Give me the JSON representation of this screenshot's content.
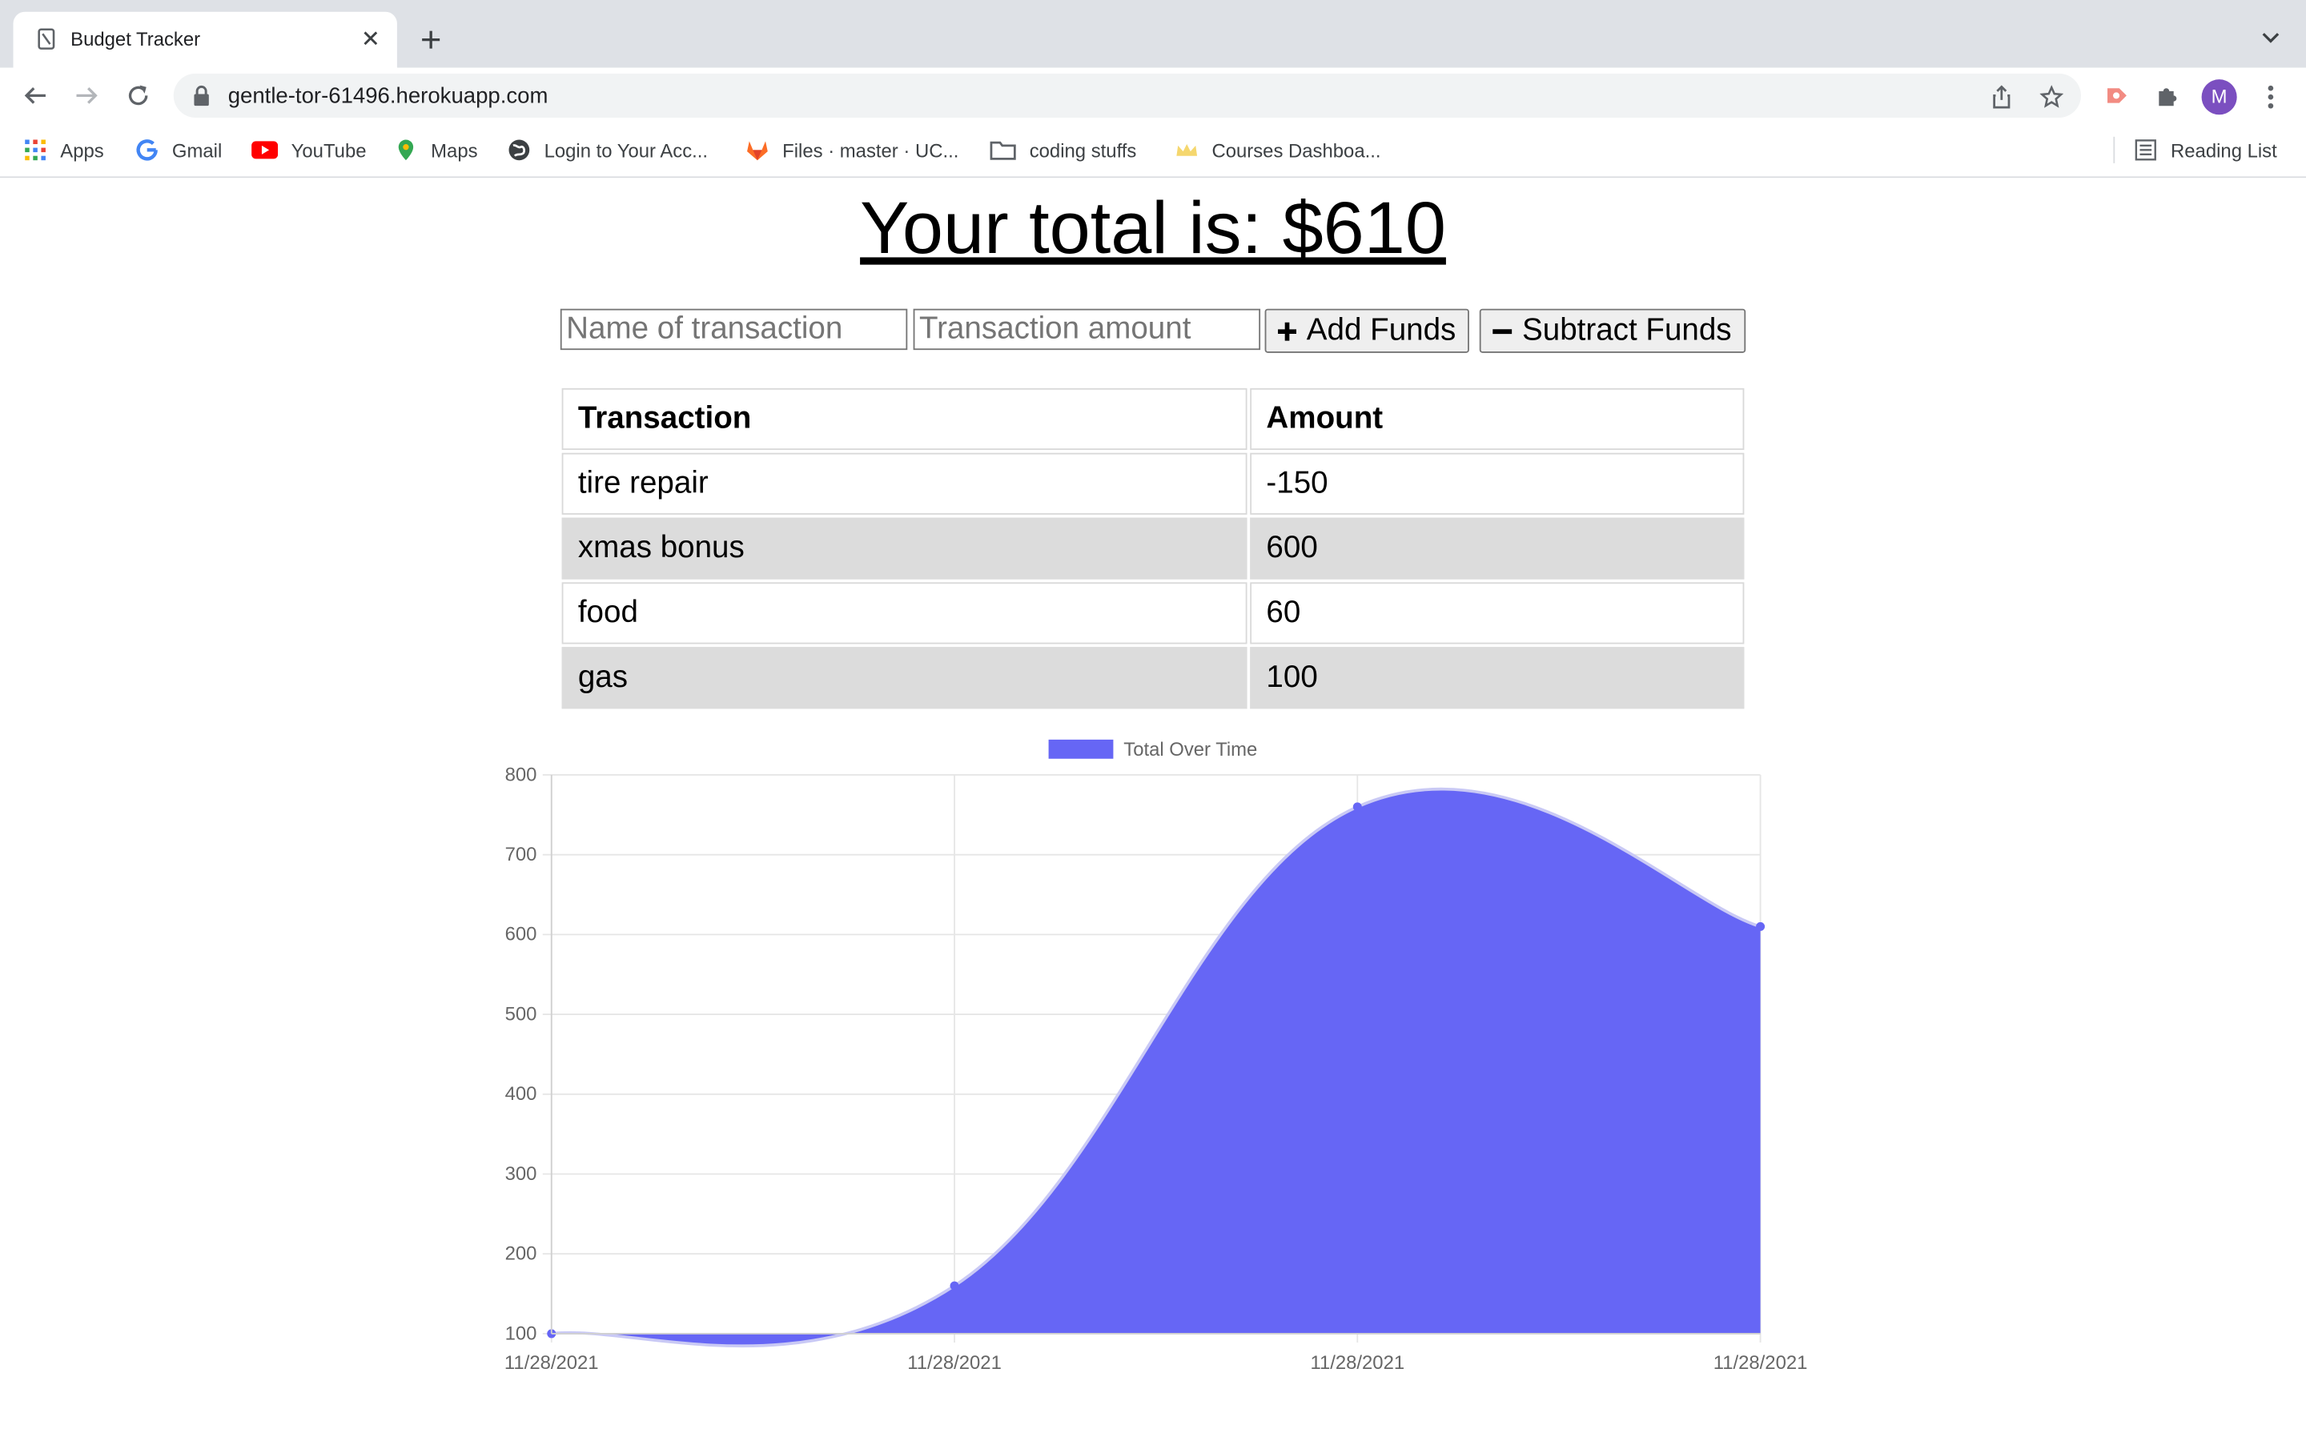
{
  "browser": {
    "tab_title": "Budget Tracker",
    "url": "gentle-tor-61496.herokuapp.com",
    "profile_initial": "M",
    "bookmarks": [
      {
        "label": "Apps",
        "icon": "apps-grid-icon"
      },
      {
        "label": "Gmail",
        "icon": "google-icon"
      },
      {
        "label": "YouTube",
        "icon": "youtube-icon"
      },
      {
        "label": "Maps",
        "icon": "maps-pin-icon"
      },
      {
        "label": "Login to Your Acc...",
        "icon": "globe-icon"
      },
      {
        "label": "Files · master · UC...",
        "icon": "gitlab-icon"
      },
      {
        "label": "coding stuffs",
        "icon": "folder-icon"
      },
      {
        "label": "Courses Dashboa...",
        "icon": "crown-icon"
      }
    ],
    "reading_list": "Reading List"
  },
  "page": {
    "total_text": "Your total is: $610",
    "name_placeholder": "Name of transaction",
    "amount_placeholder": "Transaction amount",
    "add_label": "Add Funds",
    "subtract_label": "Subtract Funds",
    "table": {
      "headers": [
        "Transaction",
        "Amount"
      ],
      "rows": [
        [
          "tire repair",
          "-150"
        ],
        [
          "xmas bonus",
          "600"
        ],
        [
          "food",
          "60"
        ],
        [
          "gas",
          "100"
        ]
      ]
    }
  },
  "colors": {
    "series_fill": "#6666f5",
    "series_line": "#c9c9f5",
    "grid": "#e6e6e6",
    "row_shade": "#dcdcdc"
  },
  "chart_data": {
    "type": "area",
    "x": [
      "11/28/2021",
      "11/28/2021",
      "11/28/2021",
      "11/28/2021"
    ],
    "series": [
      {
        "name": "Total Over Time",
        "values": [
          100,
          160,
          760,
          610
        ]
      }
    ],
    "title": "",
    "xlabel": "",
    "ylabel": "",
    "ylim": [
      100,
      800
    ],
    "yticks": [
      100,
      200,
      300,
      400,
      500,
      600,
      700,
      800
    ],
    "grid": true,
    "legend": "top-center"
  }
}
